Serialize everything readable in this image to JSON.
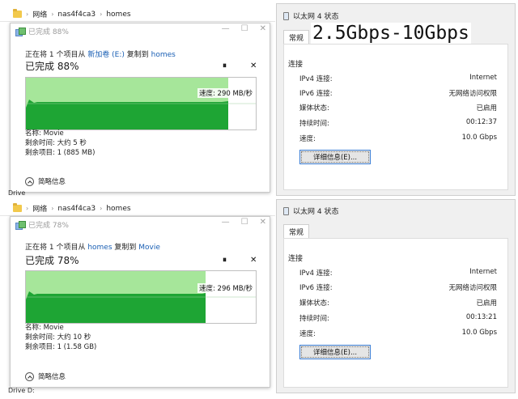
{
  "banner": "2.5Gbps-10Gbps",
  "top": {
    "breadcrumb": [
      "网络",
      "nas4f4ca3",
      "homes"
    ],
    "dialog": {
      "title": "已完成 88%",
      "line1_prefix": "正在将 1 个项目从 ",
      "source": "新加卷 (E:)",
      "mid": " 复制到 ",
      "dest": "homes",
      "done": "已完成 88%",
      "progress_fraction": 0.88,
      "pause_glyph": "⏸",
      "close_glyph": "✕",
      "speed": "速度: 290 MB/秒",
      "name": "名称: Movie",
      "time_left": "剩余时间: 大约 5 秒",
      "items_left": "剩余项目: 1 (885 MB)",
      "more": "简略信息"
    },
    "status": {
      "title": "以太网 4 状态",
      "tab": "常规",
      "section": "连接",
      "rows": [
        {
          "label": "IPv4 连接:",
          "value": "Internet"
        },
        {
          "label": "IPv6 连接:",
          "value": "无网络访问权限"
        },
        {
          "label": "媒体状态:",
          "value": "已启用"
        },
        {
          "label": "持续时间:",
          "value": "00:12:37"
        },
        {
          "label": "速度:",
          "value": "10.0 Gbps"
        }
      ],
      "detail_button": "详细信息(E)..."
    }
  },
  "bottom": {
    "breadcrumb": [
      "网络",
      "nas4f4ca3",
      "homes"
    ],
    "dialog": {
      "title": "已完成 78%",
      "line1_prefix": "正在将 1 个项目从 ",
      "source": "homes",
      "mid": " 复制到 ",
      "dest": "Movie",
      "done": "已完成 78%",
      "progress_fraction": 0.78,
      "pause_glyph": "⏸",
      "close_glyph": "✕",
      "speed": "速度: 296 MB/秒",
      "name": "名称: Movie",
      "time_left": "剩余时间: 大约 10 秒",
      "items_left": "剩余项目: 1 (1.58 GB)",
      "more": "简略信息"
    },
    "status": {
      "title": "以太网 4 状态",
      "tab": "常规",
      "section": "连接",
      "rows": [
        {
          "label": "IPv4 连接:",
          "value": "Internet"
        },
        {
          "label": "IPv6 连接:",
          "value": "无网络访问权限"
        },
        {
          "label": "媒体状态:",
          "value": "已启用"
        },
        {
          "label": "持续时间:",
          "value": "00:13:21"
        },
        {
          "label": "速度:",
          "value": "10.0 Gbps"
        }
      ],
      "detail_button": "详细信息(E)..."
    }
  },
  "fragments": {
    "top": "Drive",
    "bottom": "Drive    D:"
  },
  "colors": {
    "graph_fill": "#1ea534",
    "graph_bg": "#a6e69a",
    "link": "#1a5fb4",
    "focus": "#3c7fd6"
  }
}
